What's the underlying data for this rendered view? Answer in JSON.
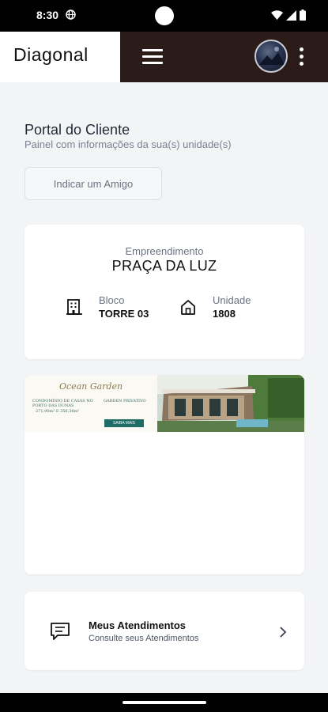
{
  "status_bar": {
    "time": "8:30",
    "icons": [
      "globe-icon",
      "wifi-icon",
      "cellular-icon",
      "battery-icon"
    ]
  },
  "header": {
    "logo": "Diagonal",
    "menu_icon": "hamburger-menu-icon",
    "more_icon": "more-vert-icon",
    "colors": {
      "bar": "#2b1c1a",
      "logo_bg": "#ffffff"
    }
  },
  "page": {
    "title": "Portal do Cliente",
    "subtitle": "Painel com informações da sua(s) unidade(s)",
    "refer_button": "Indicar um Amigo"
  },
  "enterprise": {
    "label": "Empreendimento",
    "name": "PRAÇA DA LUZ",
    "block_label": "Bloco",
    "block_value": "TORRE 03",
    "block_icon": "building-icon",
    "unit_label": "Unidade",
    "unit_value": "1808",
    "unit_icon": "home-icon"
  },
  "banner": {
    "logo": "Ocean Garden",
    "bullet_1": "CONDOMÍNIO DE CASAS NO PORTO DAS DUNAS",
    "bullet_1_detail": "271,90m² E 356,38m²",
    "bullet_2": "GARDEN PRIVATIVO",
    "cta": "SAIBA MAIS"
  },
  "atendimentos": {
    "title": "Meus Atendimentos",
    "subtitle": "Consulte seus Atendimentos",
    "icon": "chat-message-icon",
    "chevron": "chevron-right-icon"
  }
}
